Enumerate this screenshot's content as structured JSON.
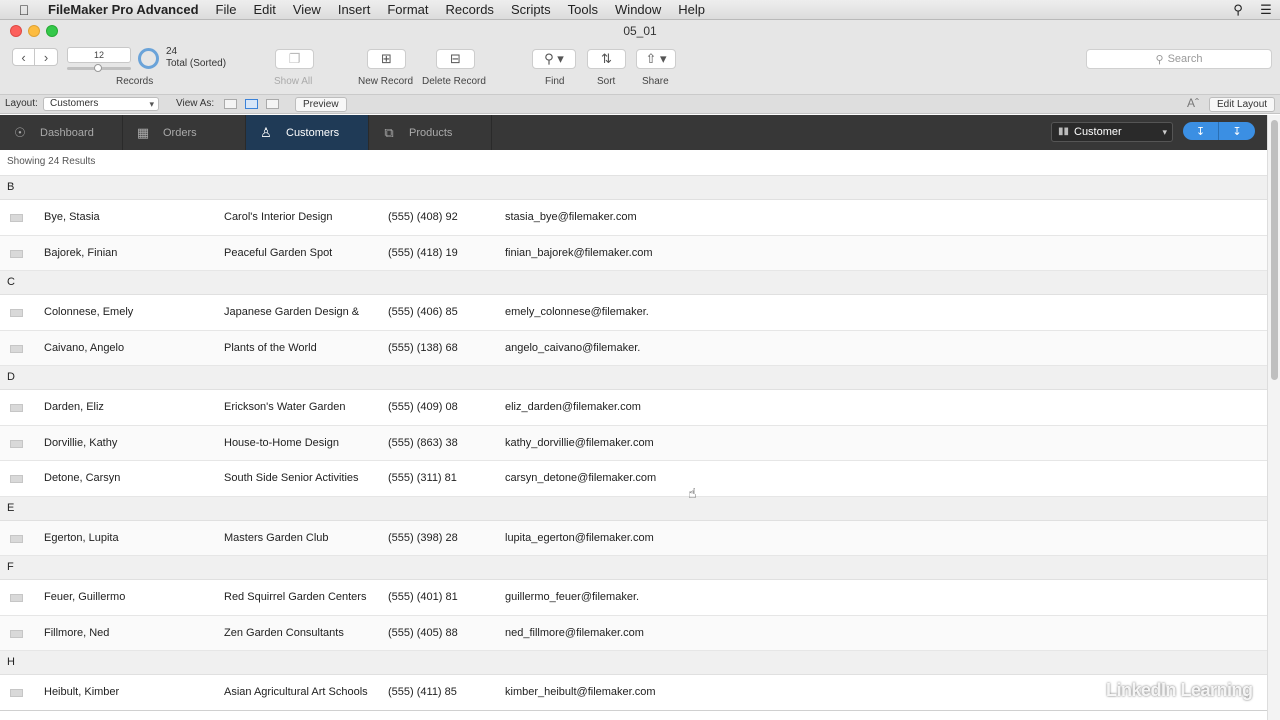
{
  "menubar": {
    "apple_icon": "apple-icon",
    "app_name": "FileMaker Pro Advanced",
    "menus": [
      "File",
      "Edit",
      "View",
      "Insert",
      "Format",
      "Records",
      "Scripts",
      "Tools",
      "Window",
      "Help"
    ]
  },
  "window": {
    "title": "05_01"
  },
  "toolbar": {
    "record_number": "12",
    "found_count": "24",
    "found_status": "Total (Sorted)",
    "records_label": "Records",
    "show_all_label": "Show All",
    "new_record_label": "New Record",
    "delete_record_label": "Delete Record",
    "find_label": "Find",
    "sort_label": "Sort",
    "share_label": "Share",
    "search_placeholder": "Search"
  },
  "layoutbar": {
    "layout_label": "Layout:",
    "layout_value": "Customers",
    "view_as_label": "View As:",
    "preview_label": "Preview",
    "edit_layout_label": "Edit Layout"
  },
  "navtabs": [
    {
      "label": "Dashboard",
      "icon": "dashboard-icon"
    },
    {
      "label": "Orders",
      "icon": "orders-icon"
    },
    {
      "label": "Customers",
      "icon": "person-icon",
      "active": true
    },
    {
      "label": "Products",
      "icon": "box-icon"
    }
  ],
  "report_select": "Customer",
  "results_text": "Showing 24 Results",
  "groups": [
    {
      "letter": "B",
      "rows": [
        {
          "name": "Bye, Stasia",
          "company": "Carol's Interior Design",
          "phone": "(555) (408) 92",
          "email": "stasia_bye@filemaker.com"
        },
        {
          "name": "Bajorek, Finian",
          "company": "Peaceful Garden Spot",
          "phone": "(555) (418) 19",
          "email": "finian_bajorek@filemaker.com"
        }
      ]
    },
    {
      "letter": "C",
      "rows": [
        {
          "name": "Colonnese, Emely",
          "company": "Japanese Garden Design &",
          "phone": "(555) (406) 85",
          "email": "emely_colonnese@filemaker."
        },
        {
          "name": "Caivano, Angelo",
          "company": "Plants of the World",
          "phone": "(555) (138) 68",
          "email": "angelo_caivano@filemaker."
        }
      ]
    },
    {
      "letter": "D",
      "rows": [
        {
          "name": "Darden, Eliz",
          "company": "Erickson's Water Garden",
          "phone": "(555) (409) 08",
          "email": "eliz_darden@filemaker.com"
        },
        {
          "name": "Dorvillie, Kathy",
          "company": "House-to-Home Design",
          "phone": "(555) (863) 38",
          "email": "kathy_dorvillie@filemaker.com"
        },
        {
          "name": "Detone, Carsyn",
          "company": "South Side Senior Activities",
          "phone": "(555) (311) 81",
          "email": "carsyn_detone@filemaker.com"
        }
      ]
    },
    {
      "letter": "E",
      "rows": [
        {
          "name": "Egerton, Lupita",
          "company": "Masters Garden Club",
          "phone": "(555) (398) 28",
          "email": "lupita_egerton@filemaker.com"
        }
      ]
    },
    {
      "letter": "F",
      "rows": [
        {
          "name": "Feuer, Guillermo",
          "company": "Red Squirrel Garden Centers",
          "phone": "(555) (401) 81",
          "email": "guillermo_feuer@filemaker."
        },
        {
          "name": "Fillmore, Ned",
          "company": "Zen Garden Consultants",
          "phone": "(555) (405) 88",
          "email": "ned_fillmore@filemaker.com"
        }
      ]
    },
    {
      "letter": "H",
      "rows": [
        {
          "name": "Heibult, Kimber",
          "company": "Asian Agricultural Art Schools",
          "phone": "(555) (411) 85",
          "email": "kimber_heibult@filemaker.com"
        }
      ]
    }
  ],
  "watermark": "LinkedIn Learning"
}
